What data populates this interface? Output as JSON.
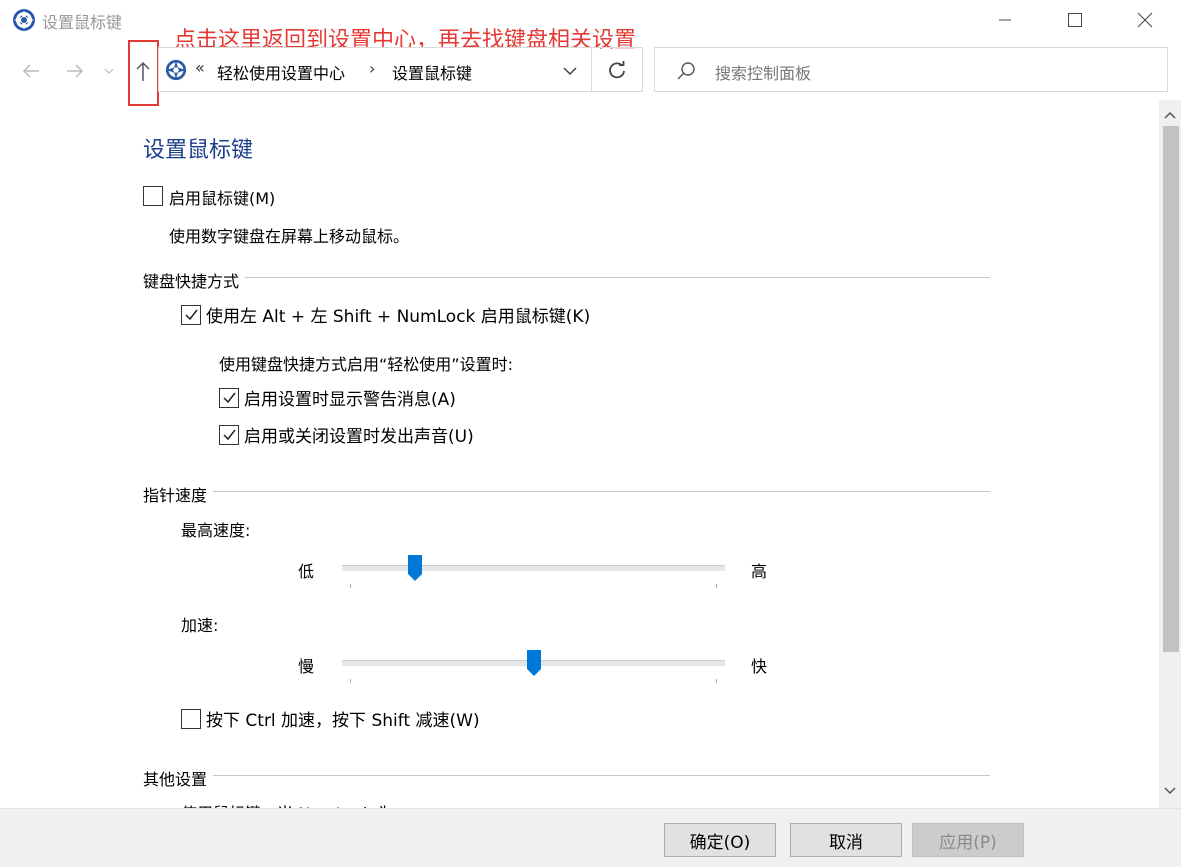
{
  "window": {
    "title": "设置鼠标键",
    "annotation": "点击这里返回到设置中心，再去找键盘相关设置"
  },
  "address": {
    "overflow": "«",
    "crumbs": [
      "轻松使用设置中心",
      "设置鼠标键"
    ],
    "separator": "›"
  },
  "search": {
    "placeholder": "搜索控制面板"
  },
  "page": {
    "heading": "设置鼠标键",
    "enable_mousekeys": {
      "label": "启用鼠标键(M)",
      "checked": false
    },
    "enable_desc": "使用数字键盘在屏幕上移动鼠标。",
    "shortcut_group": {
      "title": "键盘快捷方式",
      "shortcut_option": {
        "label": "使用左 Alt + 左 Shift + NumLock 启用鼠标键(K)",
        "checked": true
      },
      "sub_intro": "使用键盘快捷方式启用“轻松使用”设置时:",
      "warn_option": {
        "label": "启用设置时显示警告消息(A)",
        "checked": true
      },
      "sound_option": {
        "label": "启用或关闭设置时发出声音(U)",
        "checked": true
      }
    },
    "pointer_group": {
      "title": "指针速度",
      "top_speed_label": "最高速度:",
      "top_speed_low": "低",
      "top_speed_high": "高",
      "top_speed_value": 0.18,
      "accel_label": "加速:",
      "accel_low": "慢",
      "accel_high": "快",
      "accel_value": 0.5,
      "ctrl_shift_option": {
        "label": "按下 Ctrl 加速，按下 Shift 减速(W)",
        "checked": false
      }
    },
    "other_group": {
      "title": "其他设置",
      "partial_text": "使用鼠标键，当 NumLock 为"
    }
  },
  "footer": {
    "ok": "确定(O)",
    "cancel": "取消",
    "apply": "应用(P)"
  },
  "colors": {
    "accent": "#0078d7",
    "heading": "#1e3f8c",
    "annotation": "#e53935"
  }
}
